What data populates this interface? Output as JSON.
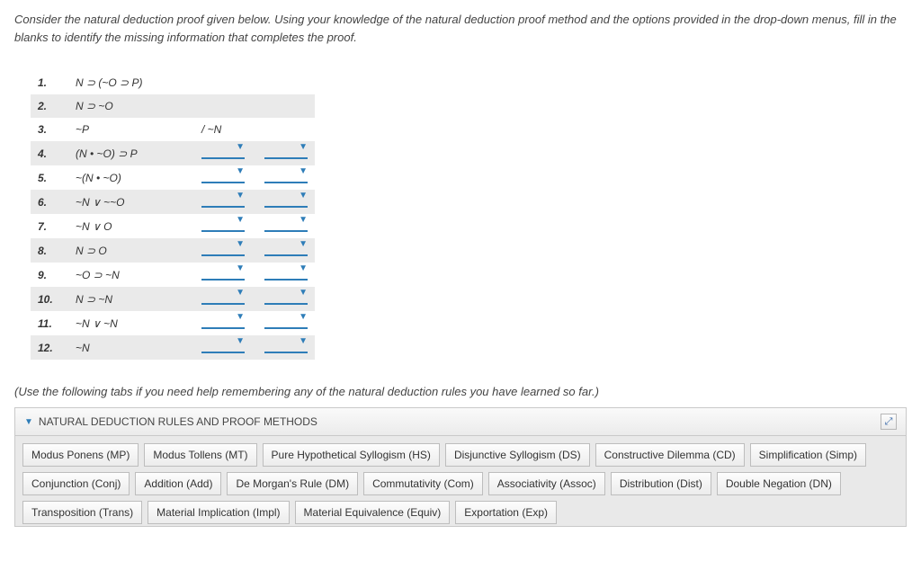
{
  "instructions": "Consider the natural deduction proof given below. Using your knowledge of the natural deduction proof method and the options provided in the drop-down menus, fill in the blanks to identify the missing information that completes the proof.",
  "proof": {
    "rows": [
      {
        "num": "1.",
        "formula": "N ⊃ (~O ⊃ P)",
        "conclude": "",
        "dd": false,
        "shaded": false
      },
      {
        "num": "2.",
        "formula": "N ⊃ ~O",
        "conclude": "",
        "dd": false,
        "shaded": true
      },
      {
        "num": "3.",
        "formula": "~P",
        "conclude": "/ ~N",
        "dd": false,
        "shaded": false
      },
      {
        "num": "4.",
        "formula": "(N • ~O) ⊃ P",
        "conclude": "",
        "dd": true,
        "shaded": true
      },
      {
        "num": "5.",
        "formula": "~(N • ~O)",
        "conclude": "",
        "dd": true,
        "shaded": false
      },
      {
        "num": "6.",
        "formula": "~N ∨ ~~O",
        "conclude": "",
        "dd": true,
        "shaded": true
      },
      {
        "num": "7.",
        "formula": "~N ∨ O",
        "conclude": "",
        "dd": true,
        "shaded": false
      },
      {
        "num": "8.",
        "formula": "N ⊃ O",
        "conclude": "",
        "dd": true,
        "shaded": true
      },
      {
        "num": "9.",
        "formula": "~O ⊃ ~N",
        "conclude": "",
        "dd": true,
        "shaded": false
      },
      {
        "num": "10.",
        "formula": "N ⊃ ~N",
        "conclude": "",
        "dd": true,
        "shaded": true
      },
      {
        "num": "11.",
        "formula": "~N ∨ ~N",
        "conclude": "",
        "dd": true,
        "shaded": false
      },
      {
        "num": "12.",
        "formula": "~N",
        "conclude": "",
        "dd": true,
        "shaded": true
      }
    ]
  },
  "hint": "(Use the following tabs if you need help remembering any of the natural deduction rules you have learned so far.)",
  "accordion": {
    "title": "NATURAL DEDUCTION RULES AND PROOF METHODS",
    "pin_icon": "⤢"
  },
  "rules": [
    "Modus Ponens (MP)",
    "Modus Tollens (MT)",
    "Pure Hypothetical Syllogism (HS)",
    "Disjunctive Syllogism (DS)",
    "Constructive Dilemma (CD)",
    "Simplification (Simp)",
    "Conjunction (Conj)",
    "Addition (Add)",
    "De Morgan's Rule (DM)",
    "Commutativity (Com)",
    "Associativity (Assoc)",
    "Distribution (Dist)",
    "Double Negation (DN)",
    "Transposition (Trans)",
    "Material Implication (Impl)",
    "Material Equivalence (Equiv)",
    "Exportation (Exp)"
  ]
}
